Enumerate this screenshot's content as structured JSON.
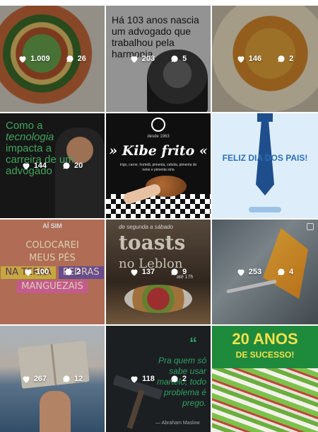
{
  "colors": {
    "overlay": "rgba(0,0,0,0.32)",
    "green_text": "#4fc870",
    "quote_green": "#35b36b",
    "anos_yellow": "#f2e14c",
    "dad_blue": "#2d6fb7"
  },
  "icons": {
    "likes": "heart-icon",
    "comments": "comment-icon"
  },
  "posts": [
    {
      "likes": "1.009",
      "comments": "26"
    },
    {
      "likes": "203",
      "comments": "5",
      "caption": "Há 103 anos nascia um advogado que trabalhou pela harmonia"
    },
    {
      "likes": "146",
      "comments": "2"
    },
    {
      "likes": "144",
      "comments": "20",
      "caption_line1": "Como a",
      "caption_line2": "tecnologia",
      "caption_line3": "impacta a",
      "caption_line4": "carreira de um",
      "caption_line5": "advogado"
    },
    {
      "likes": "",
      "comments": "",
      "badge": "desde 1963",
      "title": "» Kibe frito «",
      "subtitle": "trigo, carne, hortelã, pimenta, cebola, pimenta do reino e pimenta síria"
    },
    {
      "likes": "",
      "comments": "",
      "caption": "FELIZ DIA DOS PAIS!"
    },
    {
      "likes": "100",
      "comments": "2",
      "header": "AÍ SIM",
      "line1": "COLOCAREI",
      "line2": "MEUS PÉS",
      "line3": "NA TERRA",
      "line4": "PEDRAS",
      "line5": "MANGUEZAIS"
    },
    {
      "likes": "137",
      "comments": "9",
      "banner": "de segunda a sábado",
      "title": "toasts",
      "subtitle": "no Leblon",
      "time": "até 17h"
    },
    {
      "likes": "253",
      "comments": "4"
    },
    {
      "likes": "267",
      "comments": "12"
    },
    {
      "likes": "118",
      "comments": "2",
      "quote": "Pra quem só sabe usar martelo, todo problema é prego.",
      "author": "— Abraham Maslow"
    },
    {
      "likes": "",
      "comments": "",
      "title": "20 ANOS",
      "subtitle": "DE SUCESSO!"
    }
  ]
}
